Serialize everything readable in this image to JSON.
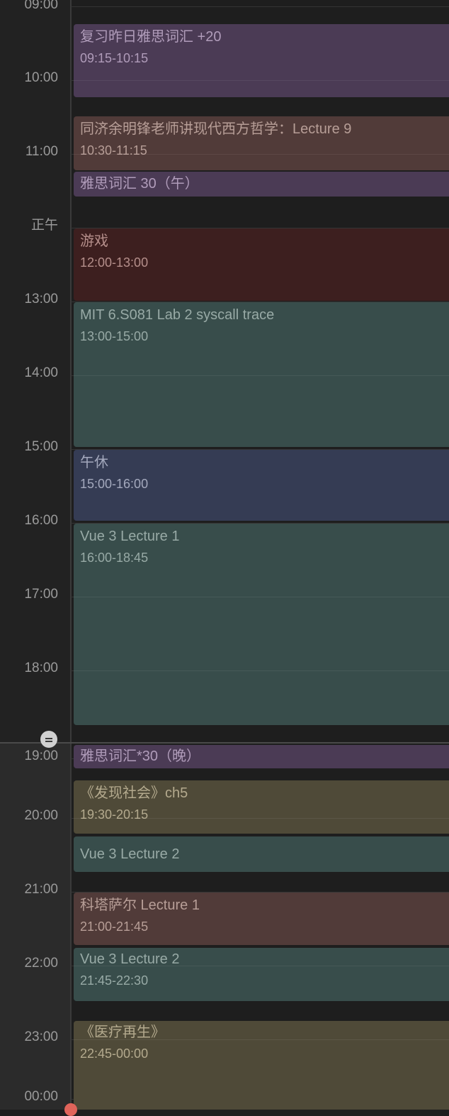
{
  "hours": [
    "09:00",
    "10:00",
    "11:00",
    "正午",
    "13:00",
    "14:00",
    "15:00",
    "16:00",
    "17:00",
    "18:00",
    "19:00",
    "20:00",
    "21:00",
    "22:00",
    "23:00",
    "00:00"
  ],
  "events": [
    {
      "title": "复习昨日雅思词汇 +20",
      "time": "09:15-10:15",
      "color": "purple"
    },
    {
      "title": "同济余明锋老师讲现代西方哲学：Lecture 9",
      "time": "10:30-11:15",
      "color": "brown"
    },
    {
      "title": "雅思词汇 30（午）",
      "time": "",
      "color": "purple"
    },
    {
      "title": "游戏",
      "time": "12:00-13:00",
      "color": "red"
    },
    {
      "title": "MIT 6.S081 Lab 2 syscall trace",
      "time": "13:00-15:00",
      "color": "teal"
    },
    {
      "title": "午休",
      "time": "15:00-16:00",
      "color": "navy"
    },
    {
      "title": "Vue 3 Lecture 1",
      "time": "16:00-18:45",
      "color": "teal"
    },
    {
      "title": "雅思词汇*30（晚）",
      "time": "",
      "color": "purple"
    },
    {
      "title": "《发现社会》ch5",
      "time": "19:30-20:15",
      "color": "olive"
    },
    {
      "title": "Vue 3 Lecture 2",
      "time": "",
      "color": "teal"
    },
    {
      "title": "科塔萨尔 Lecture 1",
      "time": "21:00-21:45",
      "color": "brown"
    },
    {
      "title": "Vue 3 Lecture 2",
      "time": "21:45-22:30",
      "color": "teal"
    },
    {
      "title": "《医疗再生》",
      "time": "22:45-00:00",
      "color": "olive"
    }
  ],
  "colors": {
    "purple": "#4b3b55",
    "brown": "#513b39",
    "red": "#3d1f1f",
    "teal": "#384d4b",
    "navy": "#353c54",
    "olive": "#4f4a38",
    "current_time_dot": "#e0645a"
  }
}
